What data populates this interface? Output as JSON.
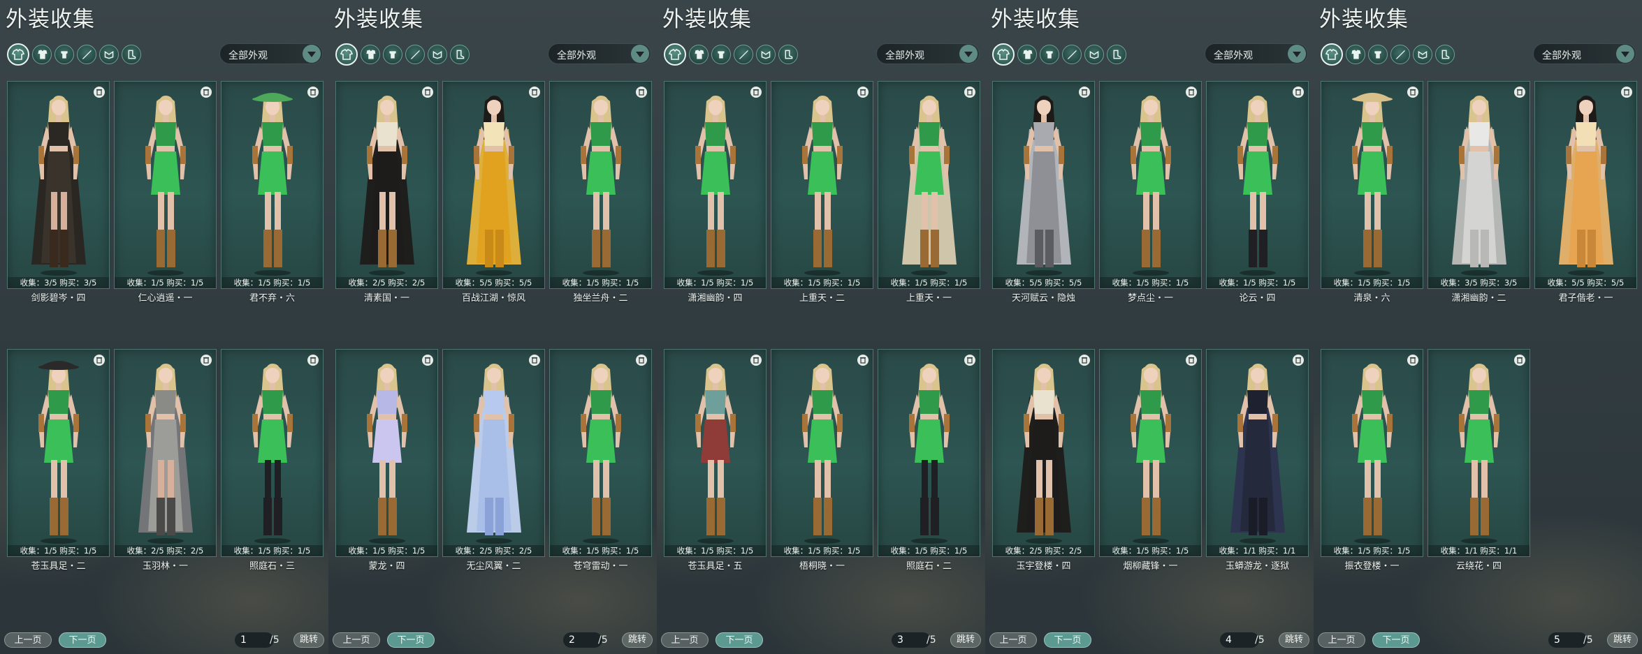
{
  "title": "外装收集",
  "filter_label": "全部外观",
  "pager": {
    "prev_label": "上一页",
    "next_label": "下一页",
    "jump_label": "跳转",
    "total": "/5"
  },
  "category_icons": [
    "all-outfits-icon",
    "top-icon",
    "hat-icon",
    "weapon-icon",
    "accessory-icon",
    "shoe-icon"
  ],
  "colors": {
    "card_bg": "#2d5552",
    "button_active": "#5c9990",
    "title": "#eef2ef"
  },
  "panels": [
    {
      "page": "1",
      "cards": [
        {
          "stats": "收集：3/5   购买：3/5",
          "name": "剑影碧岑・四",
          "outfit": "dark"
        },
        {
          "stats": "收集：1/5   购买：1/5",
          "name": "仁心逍遥・一",
          "outfit": "green"
        },
        {
          "stats": "收集：1/5   购买：1/5",
          "name": "君不弃・六",
          "outfit": "green-hat"
        },
        {
          "stats": "收集：1/5   购买：1/5",
          "name": "苍玉具足・二",
          "outfit": "green-hat-dark"
        },
        {
          "stats": "收集：2/5   购买：2/5",
          "name": "玉羽林・一",
          "outfit": "grey"
        },
        {
          "stats": "收集：1/5   购买：1/5",
          "name": "照庭石・三",
          "outfit": "green-stockings"
        }
      ]
    },
    {
      "page": "2",
      "cards": [
        {
          "stats": "收集：2/5   购买：2/5",
          "name": "清素国・一",
          "outfit": "black-white"
        },
        {
          "stats": "收集：5/5   购买：5/5",
          "name": "百战江湖・惊风",
          "outfit": "gold"
        },
        {
          "stats": "收集：1/5   购买：1/5",
          "name": "独坐兰舟・二",
          "outfit": "green"
        },
        {
          "stats": "收集：1/5   购买：1/5",
          "name": "蒙龙・四",
          "outfit": "lavender"
        },
        {
          "stats": "收集：2/5   购买：2/5",
          "name": "无尘风翼・二",
          "outfit": "light-blue"
        },
        {
          "stats": "收集：1/5   购买：1/5",
          "name": "苍穹雷动・一",
          "outfit": "green"
        }
      ]
    },
    {
      "page": "3",
      "cards": [
        {
          "stats": "收集：1/5   购买：1/5",
          "name": "潇湘幽韵・四",
          "outfit": "green"
        },
        {
          "stats": "收集：1/5   购买：1/5",
          "name": "上重天・二",
          "outfit": "green"
        },
        {
          "stats": "收集：1/5   购买：1/5",
          "name": "上重天・一",
          "outfit": "green-shawl"
        },
        {
          "stats": "收集：1/5   购买：1/5",
          "name": "苍玉具足・五",
          "outfit": "teal-red"
        },
        {
          "stats": "收集：1/5   购买：1/5",
          "name": "梧桐晓・一",
          "outfit": "green"
        },
        {
          "stats": "收集：1/5   购买：1/5",
          "name": "照庭石・二",
          "outfit": "green-stockings"
        }
      ]
    },
    {
      "page": "4",
      "cards": [
        {
          "stats": "收集：5/5   购买：5/5",
          "name": "天河赋云・隐烛",
          "outfit": "silver"
        },
        {
          "stats": "收集：1/5   购买：1/5",
          "name": "梦点尘・一",
          "outfit": "green"
        },
        {
          "stats": "收集：1/5   购买：1/5",
          "name": "论云・四",
          "outfit": "green-boots"
        },
        {
          "stats": "收集：2/5   购买：2/5",
          "name": "玉宇登楼・四",
          "outfit": "black-white"
        },
        {
          "stats": "收集：1/5   购买：1/5",
          "name": "烟柳藏锋・一",
          "outfit": "green"
        },
        {
          "stats": "收集：1/1   购买：1/1",
          "name": "玉蟒游龙・逐狱",
          "outfit": "navy"
        }
      ]
    },
    {
      "page": "5",
      "cards": [
        {
          "stats": "收集：1/5   购买：1/5",
          "name": "清泉・六",
          "outfit": "green-straw-hat"
        },
        {
          "stats": "收集：3/5   购买：3/5",
          "name": "潇湘幽韵・二",
          "outfit": "white-grey"
        },
        {
          "stats": "收集：5/5   购买：5/5",
          "name": "君子偕老・一",
          "outfit": "orange"
        },
        {
          "stats": "收集：1/5   购买：1/5",
          "name": "振衣登楼・一",
          "outfit": "green"
        },
        {
          "stats": "收集：1/1   购买：1/1",
          "name": "云绕花・四",
          "outfit": "green"
        }
      ]
    }
  ]
}
